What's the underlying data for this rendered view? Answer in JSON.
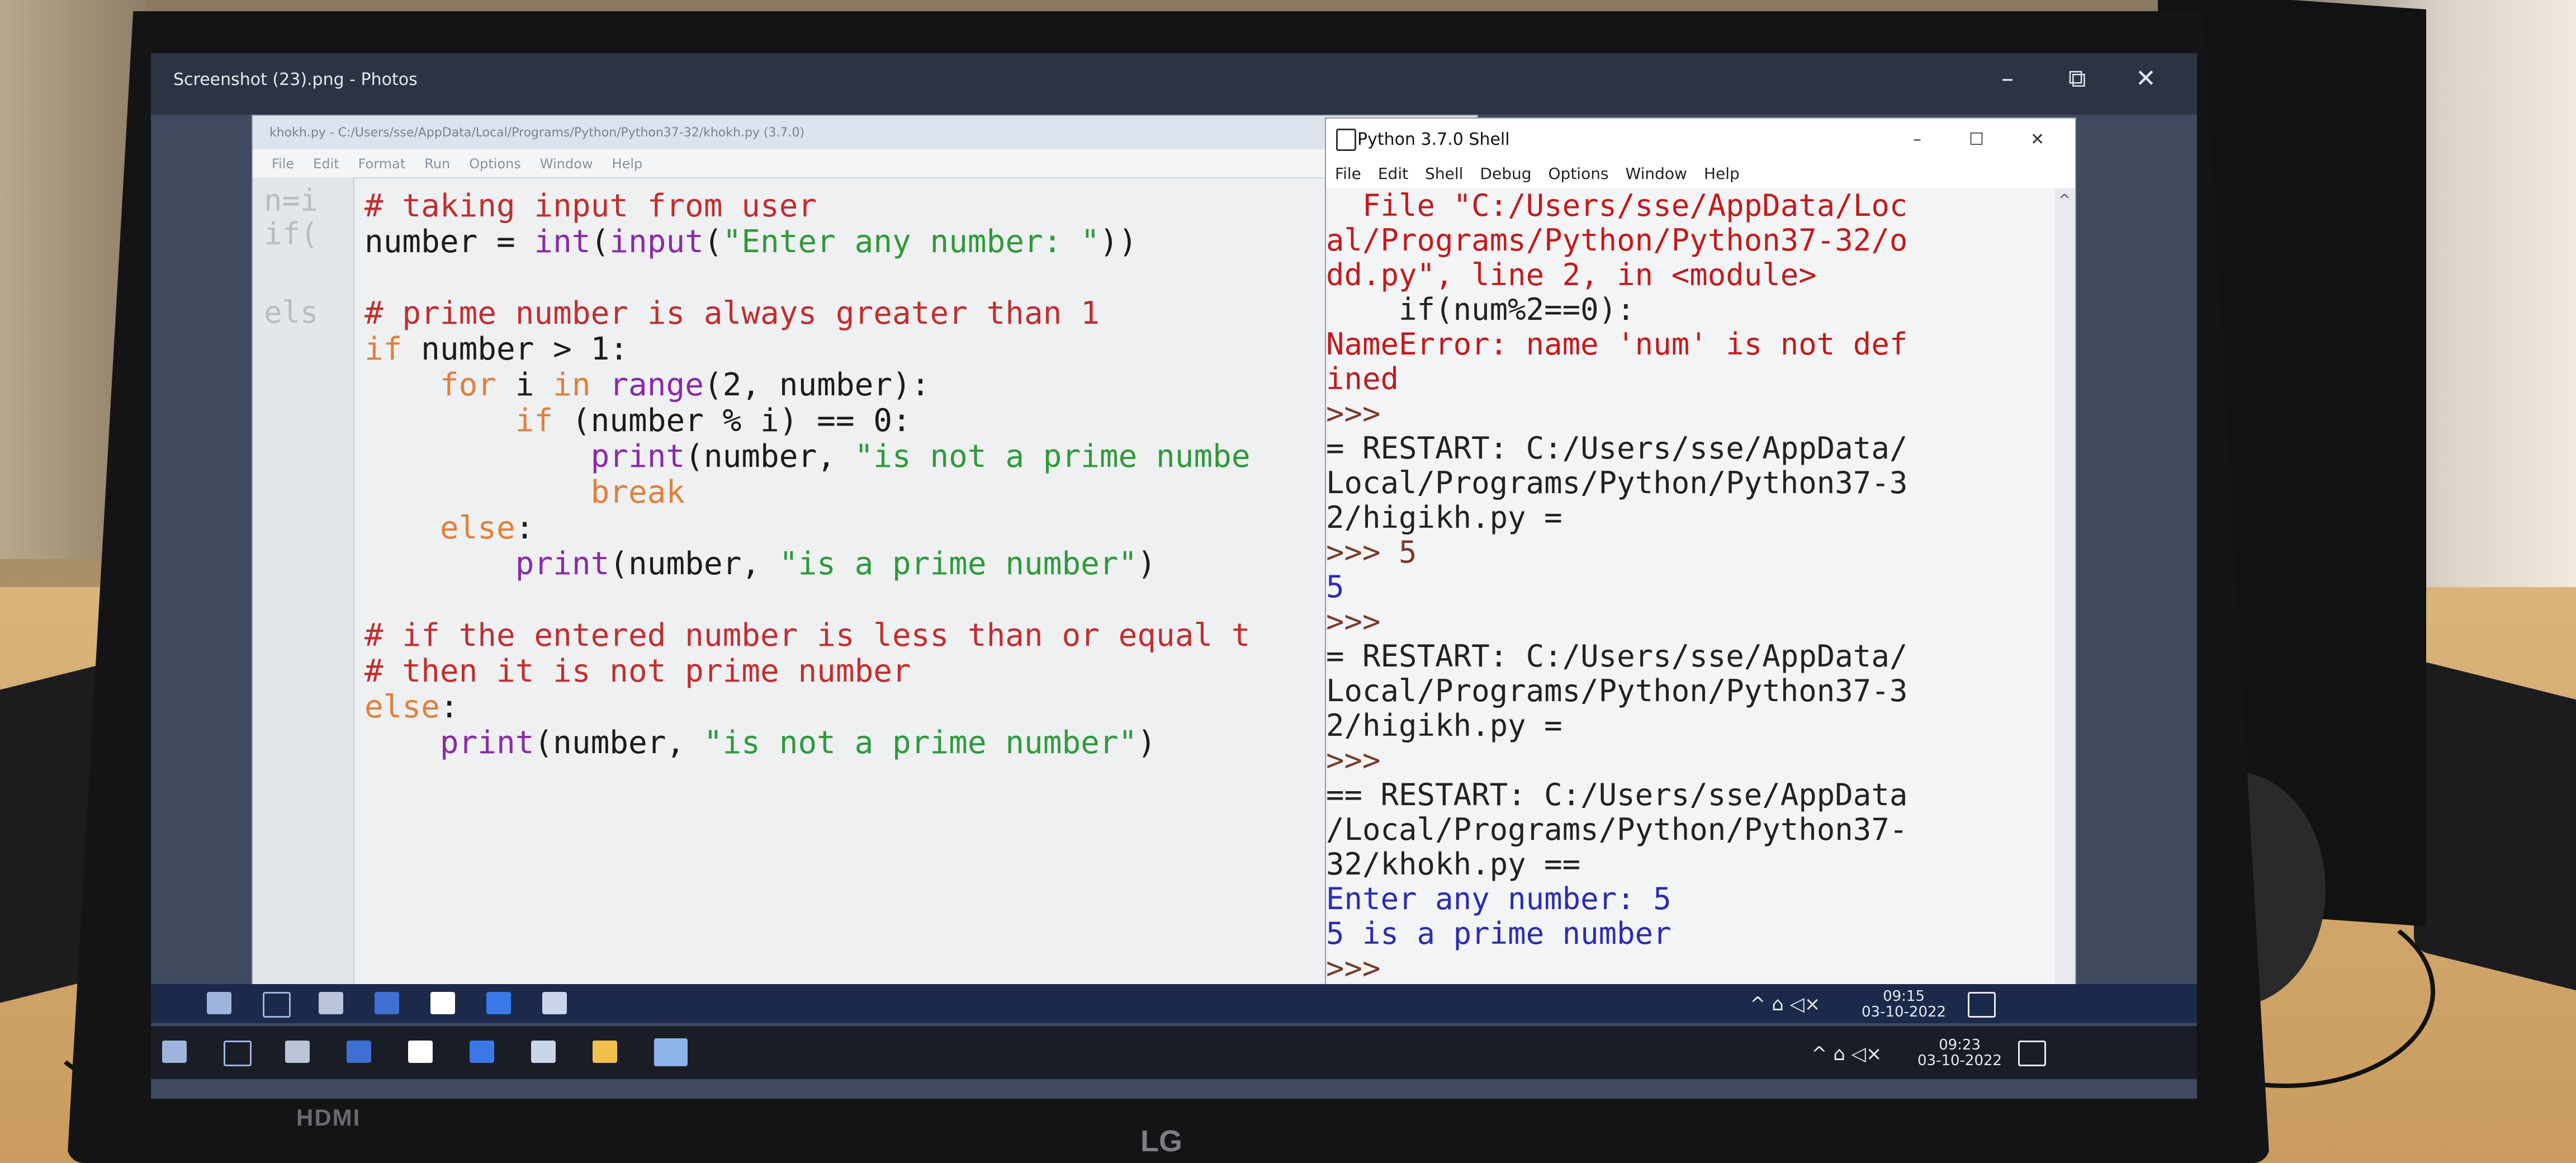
{
  "photos": {
    "title": "Screenshot (23).png - Photos",
    "minimize": "–",
    "restore": "⧉",
    "close": "✕"
  },
  "idle_editor": {
    "title": "khokh.py - C:/Users/sse/AppData/Local/Programs/Python/Python37-32/khokh.py (3.7.0)",
    "menu": [
      "File",
      "Edit",
      "Format",
      "Run",
      "Options",
      "Window",
      "Help"
    ],
    "gutter_text": [
      "n=i",
      "if(",
      "els"
    ],
    "code": [
      {
        "indent": "",
        "parts": [
          {
            "t": "# taking input from user",
            "c": "cm"
          }
        ]
      },
      {
        "indent": "",
        "parts": [
          {
            "t": "number = ",
            "c": ""
          },
          {
            "t": "int",
            "c": "bi"
          },
          {
            "t": "(",
            "c": ""
          },
          {
            "t": "input",
            "c": "bi"
          },
          {
            "t": "(",
            "c": ""
          },
          {
            "t": "\"Enter any number: \"",
            "c": "st"
          },
          {
            "t": "))",
            "c": ""
          }
        ]
      },
      {
        "indent": "",
        "parts": []
      },
      {
        "indent": "",
        "parts": [
          {
            "t": "# prime number is always greater than 1",
            "c": "cm"
          }
        ]
      },
      {
        "indent": "",
        "parts": [
          {
            "t": "if",
            "c": "kw"
          },
          {
            "t": " number > 1:",
            "c": ""
          }
        ]
      },
      {
        "indent": "    ",
        "parts": [
          {
            "t": "for",
            "c": "kw"
          },
          {
            "t": " i ",
            "c": ""
          },
          {
            "t": "in",
            "c": "kw"
          },
          {
            "t": " ",
            "c": ""
          },
          {
            "t": "range",
            "c": "bi"
          },
          {
            "t": "(2, number):",
            "c": ""
          }
        ]
      },
      {
        "indent": "        ",
        "parts": [
          {
            "t": "if",
            "c": "kw"
          },
          {
            "t": " (number % i) == 0:",
            "c": ""
          }
        ]
      },
      {
        "indent": "            ",
        "parts": [
          {
            "t": "print",
            "c": "bi"
          },
          {
            "t": "(number, ",
            "c": ""
          },
          {
            "t": "\"is not a prime numbe",
            "c": "st"
          }
        ]
      },
      {
        "indent": "            ",
        "parts": [
          {
            "t": "break",
            "c": "kw"
          }
        ]
      },
      {
        "indent": "    ",
        "parts": [
          {
            "t": "else",
            "c": "kw"
          },
          {
            "t": ":",
            "c": ""
          }
        ]
      },
      {
        "indent": "        ",
        "parts": [
          {
            "t": "print",
            "c": "bi"
          },
          {
            "t": "(number, ",
            "c": ""
          },
          {
            "t": "\"is a prime number\"",
            "c": "st"
          },
          {
            "t": ")",
            "c": ""
          }
        ]
      },
      {
        "indent": "",
        "parts": []
      },
      {
        "indent": "",
        "parts": [
          {
            "t": "# if the entered number is less than or equal t",
            "c": "cm"
          }
        ]
      },
      {
        "indent": "",
        "parts": [
          {
            "t": "# then it is not prime number",
            "c": "cm"
          }
        ]
      },
      {
        "indent": "",
        "parts": [
          {
            "t": "else",
            "c": "kw"
          },
          {
            "t": ":",
            "c": ""
          }
        ]
      },
      {
        "indent": "    ",
        "parts": [
          {
            "t": "print",
            "c": "bi"
          },
          {
            "t": "(number, ",
            "c": ""
          },
          {
            "t": "\"is not a prime number\"",
            "c": "st"
          },
          {
            "t": ")",
            "c": ""
          }
        ]
      }
    ]
  },
  "shell": {
    "title": "Python 3.7.0 Shell",
    "minimize": "–",
    "maximize": "☐",
    "close": "✕",
    "menu": [
      "File",
      "Edit",
      "Shell",
      "Debug",
      "Options",
      "Window",
      "Help"
    ],
    "lines": [
      {
        "t": "  File \"C:/Users/sse/AppData/Loc",
        "c": "err"
      },
      {
        "t": "al/Programs/Python/Python37-32/o",
        "c": "err"
      },
      {
        "t": "dd.py\", line 2, in <module>",
        "c": "err"
      },
      {
        "t": "    if(num%2==0):",
        "c": "restart"
      },
      {
        "t": "NameError: name 'num' is not def",
        "c": "err"
      },
      {
        "t": "ined",
        "c": "err"
      },
      {
        "t": ">>>",
        "c": "prompt"
      },
      {
        "t": "= RESTART: C:/Users/sse/AppData/",
        "c": "restart"
      },
      {
        "t": "Local/Programs/Python/Python37-3",
        "c": "restart"
      },
      {
        "t": "2/higikh.py =",
        "c": "restart"
      },
      {
        "t": ">>> 5",
        "c": "prompt"
      },
      {
        "t": "5",
        "c": "sout"
      },
      {
        "t": ">>>",
        "c": "prompt"
      },
      {
        "t": "= RESTART: C:/Users/sse/AppData/",
        "c": "restart"
      },
      {
        "t": "Local/Programs/Python/Python37-3",
        "c": "restart"
      },
      {
        "t": "2/higikh.py =",
        "c": "restart"
      },
      {
        "t": ">>>",
        "c": "prompt"
      },
      {
        "t": "== RESTART: C:/Users/sse/AppData",
        "c": "restart"
      },
      {
        "t": "/Local/Programs/Python/Python37-",
        "c": "restart"
      },
      {
        "t": "32/khokh.py ==",
        "c": "restart"
      },
      {
        "t": "Enter any number: 5",
        "c": "sout"
      },
      {
        "t": "5 is a prime number",
        "c": "sout"
      },
      {
        "t": ">>>",
        "c": "prompt"
      }
    ]
  },
  "taskbar_inner": {
    "time": "09:15",
    "date": "03-10-2022",
    "tray": "^ ⌂ ◁×"
  },
  "taskbar_outer": {
    "time": "09:23",
    "date": "03-10-2022",
    "tray": "^ ⌂ ◁×"
  },
  "monitor": {
    "hdmi_label": "HDMI",
    "brand": "LG"
  }
}
